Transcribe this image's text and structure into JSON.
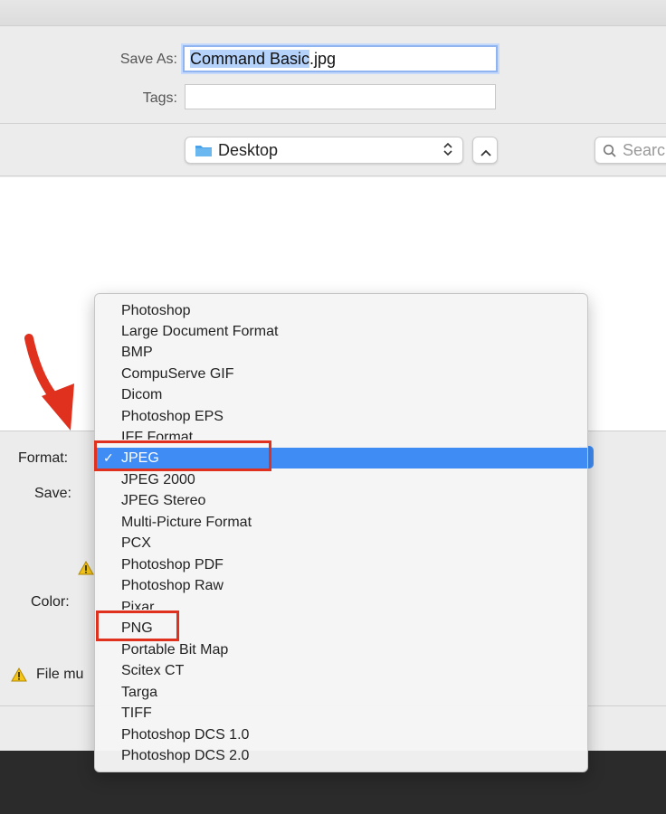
{
  "save_panel": {
    "save_as_label": "Save As:",
    "filename_selected": "Command Basic",
    "filename_ext": ".jpg",
    "tags_label": "Tags:",
    "tags_value": "",
    "location": "Desktop",
    "search_placeholder": "Searc"
  },
  "options": {
    "format_label": "Format:",
    "save_label": "Save:",
    "color_label": "Color:",
    "warning_text": "File mu"
  },
  "format_menu": {
    "items": [
      "Photoshop",
      "Large Document Format",
      "BMP",
      "CompuServe GIF",
      "Dicom",
      "Photoshop EPS",
      "IFF Format",
      "JPEG",
      "JPEG 2000",
      "JPEG Stereo",
      "Multi-Picture Format",
      "PCX",
      "Photoshop PDF",
      "Photoshop Raw",
      "Pixar",
      "PNG",
      "Portable Bit Map",
      "Scitex CT",
      "Targa",
      "TIFF",
      "Photoshop DCS 1.0",
      "Photoshop DCS 2.0"
    ],
    "selected": "JPEG"
  },
  "colors": {
    "highlight": "#3f8cf5",
    "annotation_red": "#e0301e",
    "warning_yellow": "#f5c518"
  }
}
